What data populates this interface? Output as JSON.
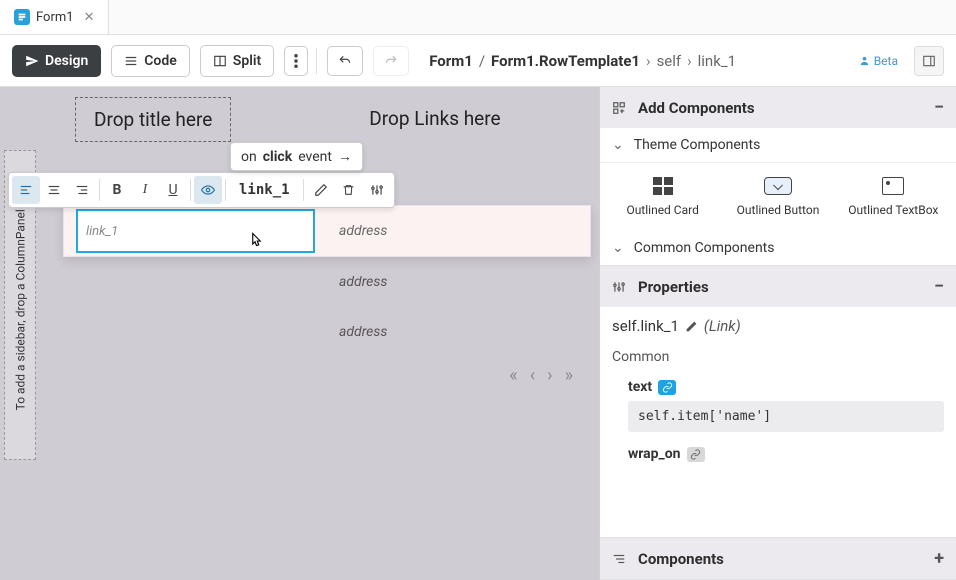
{
  "tab": {
    "title": "Form1"
  },
  "toolbar": {
    "design": "Design",
    "code": "Code",
    "split": "Split",
    "beta": "Beta"
  },
  "breadcrumb": {
    "root": "Form1",
    "sub": "Form1.RowTemplate1",
    "self": "self",
    "leaf": "link_1"
  },
  "canvas": {
    "drop_title": "Drop title here",
    "drop_links": "Drop Links here",
    "sidebar_hint": "To add a sidebar, drop a ColumnPanel h",
    "click_event_prefix": "on",
    "click_event_kw": "click",
    "click_event_suffix": "event",
    "selected_name": "link_1",
    "link_placeholder": "link_1",
    "rows": [
      {
        "col1": "",
        "col2": "address"
      },
      {
        "col1": "",
        "col2": "address"
      },
      {
        "col1": "",
        "col2": "address"
      }
    ]
  },
  "panels": {
    "add_components": "Add Components",
    "theme_components": "Theme Components",
    "common_components": "Common Components",
    "properties": "Properties",
    "components": "Components",
    "comp_items": [
      {
        "label": "Outlined Card"
      },
      {
        "label": "Outlined Button"
      },
      {
        "label": "Outlined TextBox"
      }
    ],
    "props": {
      "selector": "self.link_1",
      "type": "(Link)",
      "group": "Common",
      "text_label": "text",
      "text_value": "self.item['name']",
      "wrap_label": "wrap_on"
    }
  }
}
